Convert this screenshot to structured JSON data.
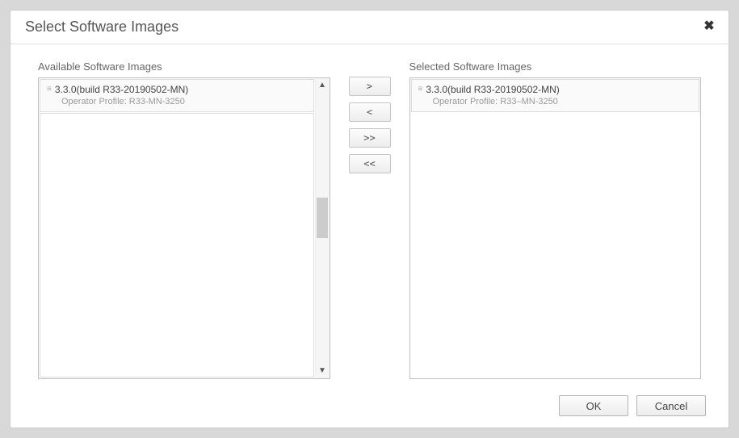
{
  "dialog": {
    "title": "Select Software Images"
  },
  "available": {
    "label": "Available Software Images",
    "items": [
      {
        "title": "3.3.0(build R33-20190502-MN)",
        "profile_label": "Operator Profile:",
        "profile_value": "R33-MN-3250"
      }
    ]
  },
  "selected": {
    "label": "Selected Software Images",
    "items": [
      {
        "title": "3.3.0(build R33-20190502-MN)",
        "profile_label": "Operator Profile:",
        "profile_value": "R33–MN-3250"
      }
    ]
  },
  "transfer": {
    "add": ">",
    "remove": "<",
    "add_all": ">>",
    "remove_all": "<<"
  },
  "footer": {
    "ok": "OK",
    "cancel": "Cancel"
  }
}
